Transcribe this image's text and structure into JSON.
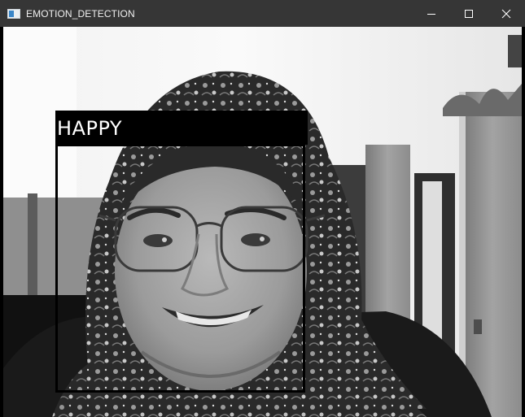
{
  "window": {
    "title": "EMOTION_DETECTION",
    "icon": "window-app-icon",
    "controls": [
      "minimize-icon",
      "maximize-icon",
      "close-icon"
    ]
  },
  "camera_feed": {
    "detection": {
      "label": "HAPPY"
    }
  },
  "colors": {
    "titlebar": "#363636",
    "label_background": "#000000",
    "label_text": "#ffffff",
    "box_stroke": "#000000"
  }
}
